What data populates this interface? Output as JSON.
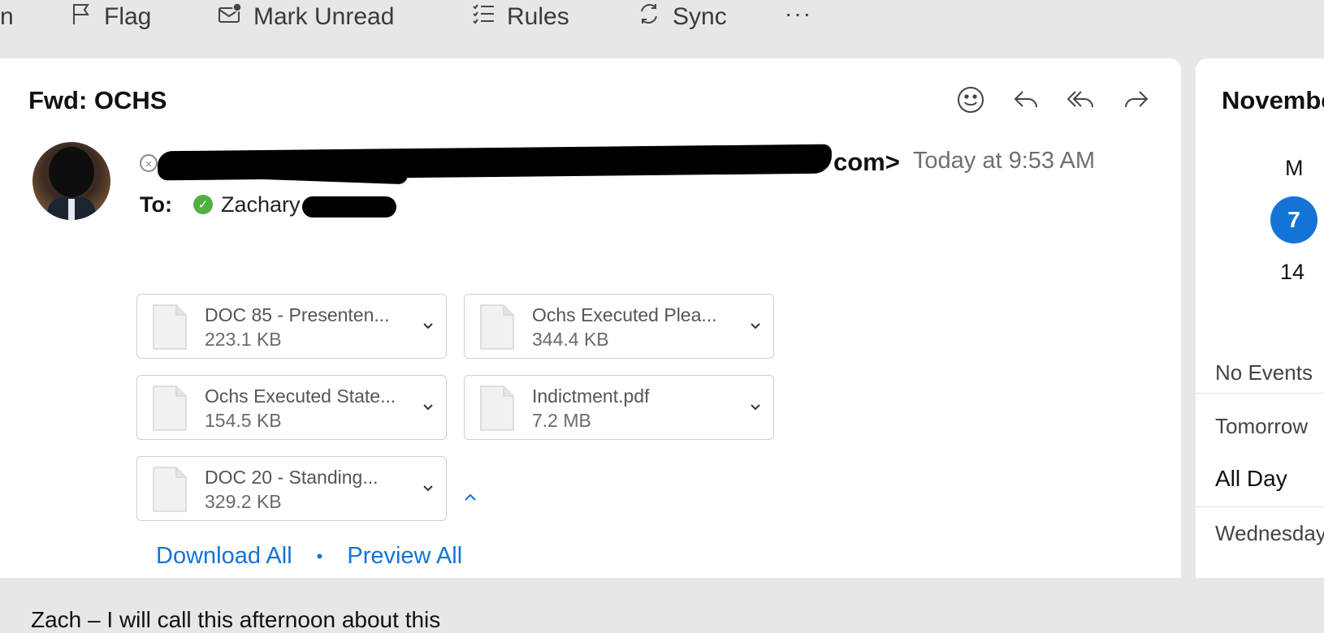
{
  "toolbar": {
    "partial_label": "n",
    "flag": "Flag",
    "mark_unread": "Mark Unread",
    "rules": "Rules",
    "sync": "Sync",
    "more": "···"
  },
  "email": {
    "subject": "Fwd: OCHS",
    "from_visible": "com>",
    "date": "Today at 9:53 AM",
    "to_label": "To:",
    "to_name": "Zachary",
    "attachments": [
      {
        "name": "DOC 85 - Presenten...",
        "size": "223.1 KB"
      },
      {
        "name": "Ochs Executed Plea...",
        "size": "344.4 KB"
      },
      {
        "name": "Ochs Executed State...",
        "size": "154.5 KB"
      },
      {
        "name": "Indictment.pdf",
        "size": "7.2 MB"
      },
      {
        "name": "DOC 20 - Standing...",
        "size": "329.2 KB"
      }
    ],
    "download_all": "Download All",
    "separator": "•",
    "preview_all": "Preview All",
    "body_partial": "Zach – I will call this afternoon about this"
  },
  "calendar": {
    "month": "November",
    "weekday": "M",
    "today": "7",
    "next_week_day": "14",
    "no_events": "No Events",
    "tomorrow": "Tomorrow",
    "all_day": "All Day",
    "wednesday": "Wednesday"
  },
  "colors": {
    "accent": "#1473d6",
    "presence_green": "#52b043",
    "toolbar_bg": "#e6e7e8"
  }
}
